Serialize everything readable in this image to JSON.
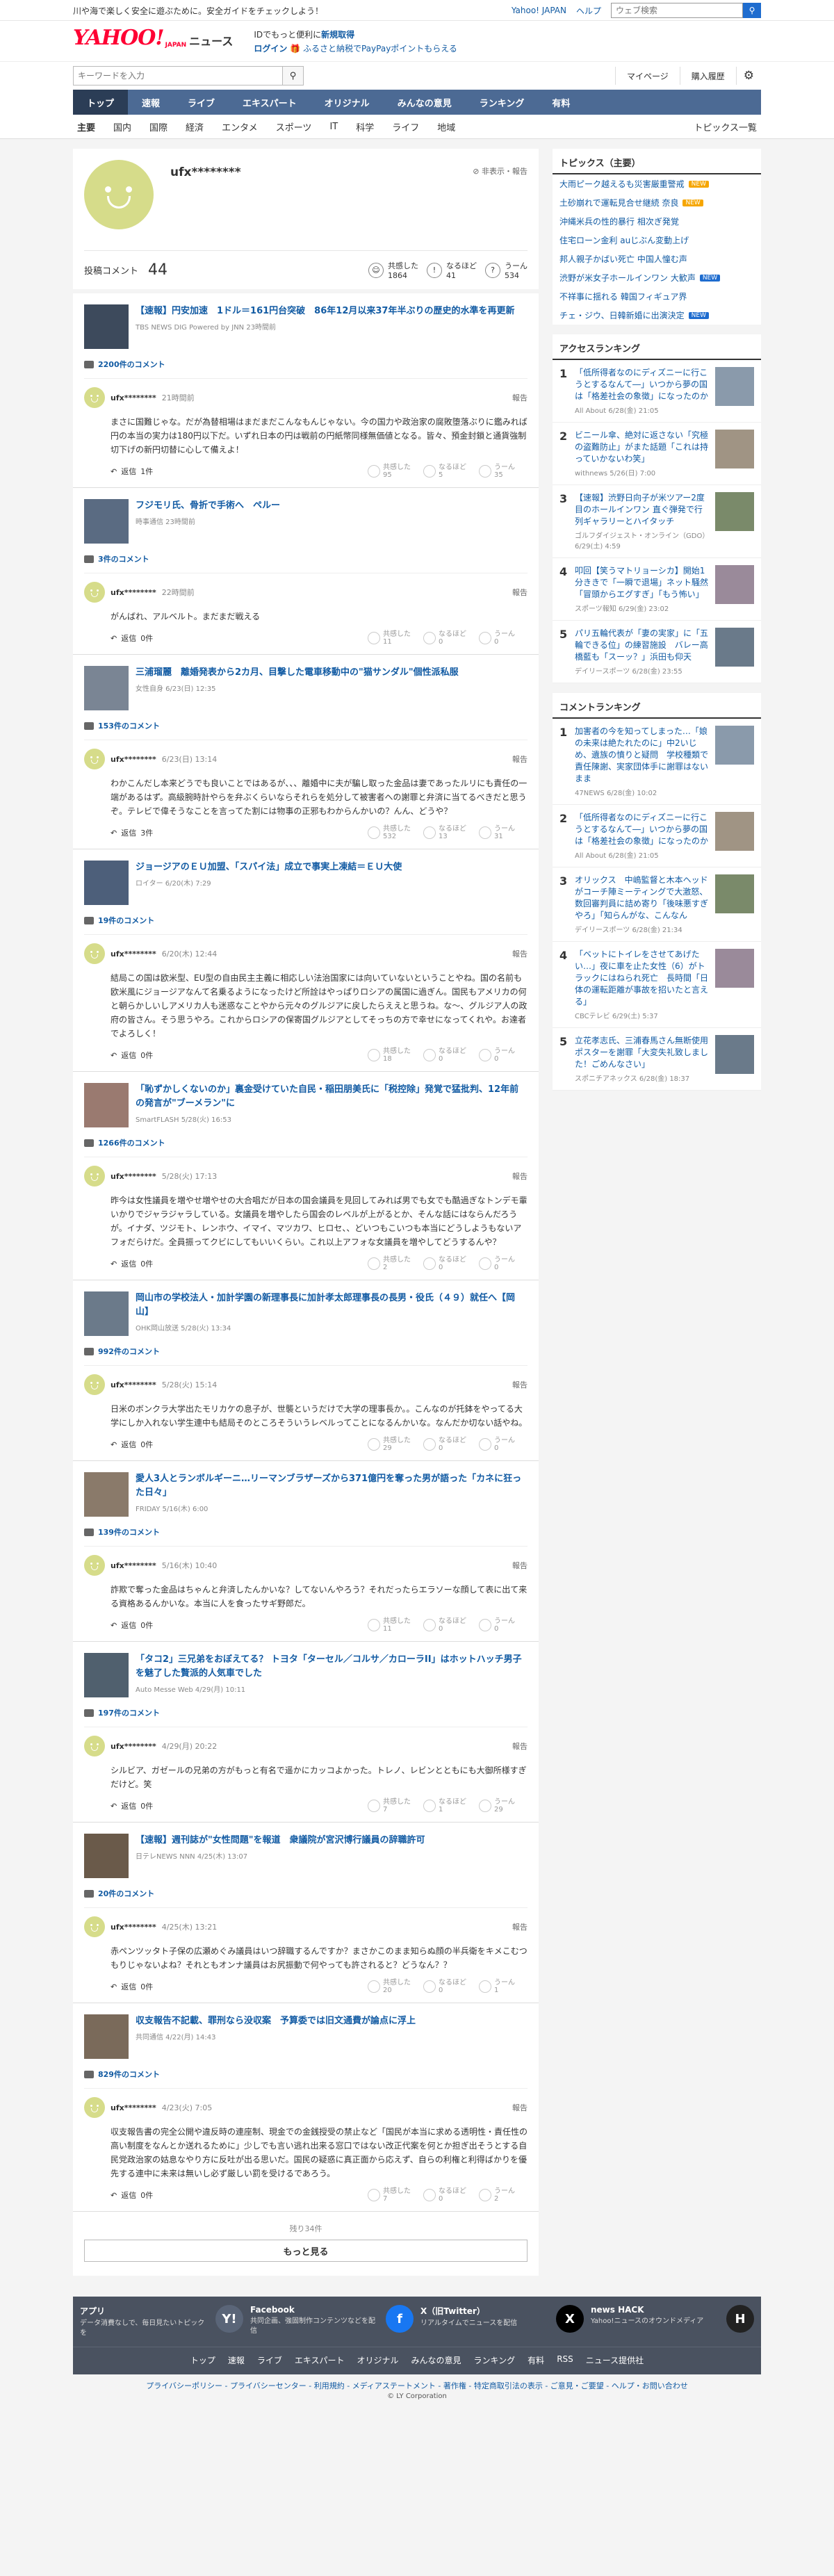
{
  "topbar": {
    "message": "川や海で楽しく安全に遊ぶために。安全ガイドをチェックしよう！",
    "link_japan": "Yahoo! JAPAN",
    "link_help": "ヘルプ",
    "search_placeholder": "ウェブ検索"
  },
  "header": {
    "logo": "YAHOO!",
    "logo_sub": "JAPAN",
    "logo_news": "ニュース",
    "promo_line1_a": "IDでもっと便利に",
    "promo_line1_b": "新規取得",
    "promo_login": "ログイン",
    "promo_line2": "ふるさと納税でPayPayポイントもらえる"
  },
  "searchrow": {
    "placeholder": "キーワードを入力",
    "mypage": "マイページ",
    "purchase": "購入履歴"
  },
  "nav": [
    "トップ",
    "速報",
    "ライブ",
    "エキスパート",
    "オリジナル",
    "みんなの意見",
    "ランキング",
    "有料"
  ],
  "subnav": [
    "主要",
    "国内",
    "国際",
    "経済",
    "エンタメ",
    "スポーツ",
    "IT",
    "科学",
    "ライフ",
    "地域"
  ],
  "subnav_topics": "トピックス一覧",
  "profile": {
    "name": "ufx********",
    "meta": "非表示・報告",
    "count_label": "投稿コメント",
    "count": "44",
    "stat_kyokan": "共感した",
    "stat_kyokan_n": "1864",
    "stat_naruhodo": "なるほど",
    "stat_naruhodo_n": "41",
    "stat_uun": "うーん",
    "stat_uun_n": "534"
  },
  "report_label": "報告",
  "reply_suffix": "返信",
  "react_labels": [
    "共感した",
    "なるほど",
    "うーん"
  ],
  "entries": [
    {
      "title": "【速報】円安加速　1ドル＝161円台突破　86年12月以来37年半ぶりの歴史的水準を再更新",
      "src": "TBS NEWS DIG Powered by JNN  23時間前",
      "count": "2200件のコメント",
      "user": "ufx********",
      "time": "21時間前",
      "text": "まさに国難じゃな。だが為替相場はまだまだこんなもんじゃない。今の国力や政治家の腐敗堕落ぶりに鑑みれば円の本当の実力は180円以下だ。いずれ日本の円は戦前の円紙幣同様無価値となる。皆々、預金封鎖と通貨強制切下げの新円切替に心して備えよ！",
      "replies": "1件",
      "r": [
        "95",
        "5",
        "35"
      ]
    },
    {
      "title": "フジモリ氏、骨折で手術へ　ペルー",
      "src": "時事通信  23時間前",
      "count": "3件のコメント",
      "user": "ufx********",
      "time": "22時間前",
      "text": "がんばれ、アルベルト。まだまだ戦える",
      "replies": "0件",
      "r": [
        "11",
        "0",
        "0"
      ]
    },
    {
      "title": "三浦瑠麗　離婚発表から2カ月、目撃した電車移動中の\"猫サンダル\"個性派私服",
      "src": "女性自身  6/23(日) 12:35",
      "count": "153件のコメント",
      "user": "ufx********",
      "time": "6/23(日) 13:14",
      "text": "わかこんだし本来どうでも良いことではあるが、、、離婚中に夫が騙し取った金品は妻であったルリにも責任の一端があるはず。高級腕時計やらを弁ぶくらいならそれらを処分して被害者への謝罪と弁済に当てるべきだと思うぞ。テレビで偉そうなことを言ってた割には物事の正邪もわからんかいの？んん、どうや？",
      "replies": "3件",
      "r": [
        "532",
        "13",
        "31"
      ]
    },
    {
      "title": "ジョージアのＥＵ加盟、「スパイ法」成立で事実上凍結＝ＥＵ大使",
      "src": "ロイター  6/20(木) 7:29",
      "count": "19件のコメント",
      "user": "ufx********",
      "time": "6/20(木) 12:44",
      "text": "結局この国は欧米型、EU型の自由民主主義に相応しい法治国家には向いていないということやね。国の名前も欧米風にジョージアなんて名乗るようになったけど所詮はやっぱりロシアの属国に過ぎん。国民もアメリカの何と朝らかしいしアメリカ人も迷惑なことやから元々のグルジアに戻したらええと思うね。な～、グルジア人の政府の皆さん。そう思うやろ。これからロシアの保寄国グルジアとしてそっちの方で幸せになってくれや。お達者でよろしく！",
      "replies": "0件",
      "r": [
        "18",
        "0",
        "0"
      ]
    },
    {
      "title": "「恥ずかしくないのか」裏金受けていた自民・稲田朋美氏に「税控除」発覚で猛批判、12年前の発言が\"ブーメラン\"に",
      "src": "SmartFLASH  5/28(火) 16:53",
      "count": "1266件のコメント",
      "user": "ufx********",
      "time": "5/28(火) 17:13",
      "text": "昨今は女性議員を増やせ増やせの大合唱だが日本の国会議員を見回してみれば男でも女でも酷過ぎなトンデモ輩いかりでジャラジャラしている。女議員を増やしたら国会のレベルが上がるとか、そんな話にはならんだろうが。イナダ、ツジモト、レンホウ、イマイ、マツカワ、ヒロセ、、どいつもこいつも本当にどうしようもないアフォだらけだ。全員振ってクビにしてもいいくらい。これ以上アフォな女議員を増やしてどうするんや？",
      "replies": "0件",
      "r": [
        "2",
        "0",
        "0"
      ]
    },
    {
      "title": "岡山市の学校法人・加計学園の新理事長に加計孝太郎理事長の長男・役氏（４９）就任へ【岡山】",
      "src": "OHK岡山放送  5/28(火) 13:34",
      "count": "992件のコメント",
      "user": "ufx********",
      "time": "5/28(火) 15:14",
      "text": "日米のボンクラ大学出たモリカケの息子が、世襲というだけで大学の理事長か。。こんなのが托鉢をやってる大学にしか入れない学生連中も結局そのところそういうレベルってことになるんかいな。なんだか切ない話やね。",
      "replies": "0件",
      "r": [
        "29",
        "0",
        "0"
      ]
    },
    {
      "title": "愛人3人とランボルギーニ…リーマンブラザーズから371億円を奪った男が語った「カネに狂った日々」",
      "src": "FRIDAY  5/16(木) 6:00",
      "count": "139件のコメント",
      "user": "ufx********",
      "time": "5/16(木) 10:40",
      "text": "詐欺で奪った金品はちゃんと弁済したんかいな？してないんやろう？それだったらエラソーな顔して表に出て来る資格あるんかいな。本当に人を食ったサギ野郎だ。",
      "replies": "0件",
      "r": [
        "11",
        "0",
        "0"
      ]
    },
    {
      "title": "「タコ2」三兄弟をおぼえてる？ トヨタ「ターセル／コルサ／カローラII」はホットハッチ男子を魅了した贅派的人気車でした",
      "src": "Auto Messe Web  4/29(月) 10:11",
      "count": "197件のコメント",
      "user": "ufx********",
      "time": "4/29(月) 20:22",
      "text": "シルビア、ガゼールの兄弟の方がもっと有名で遥かにカッコよかった。トレノ、レビンとともにも大御所様すぎだけど。笑",
      "replies": "0件",
      "r": [
        "7",
        "1",
        "29"
      ]
    },
    {
      "title": "【速報】週刊誌が\"女性問題\"を報道　衆議院が宮沢博行議員の辞職許可",
      "src": "日テレNEWS NNN  4/25(木) 13:07",
      "count": "20件のコメント",
      "user": "ufx********",
      "time": "4/25(木) 13:21",
      "text": "赤ペンツッタト子保の広瀬めぐみ議員はいつ辞職するんですか？まさかこのまま知らぬ顔の半兵衛をキメこむつもりじゃないよね？それともオンナ議員はお尻振動で何やっても許されると？どうなん？？",
      "replies": "0件",
      "r": [
        "20",
        "0",
        "1"
      ]
    },
    {
      "title": "収支報告不記載、罪刑なら没収案　予算委では旧文通費が論点に浮上",
      "src": "共同通信  4/22(月) 14:43",
      "count": "829件のコメント",
      "user": "ufx********",
      "time": "4/23(火) 7:05",
      "text": "収支報告書の完全公開や違反時の連座制、現金での金銭授受の禁止など「国民が本当に求める透明性・責任性の高い制度をなんとか送れるために」少しでも言い逃れ出来る窓口ではない改正代案を何とか担ぎ出そうとする自民党政治家の姑息なやり方に反吐が出る思いだ。国民の疑惑に真正面から応えず、自らの利権と利得ばかりを優先する連中に未来は無いし必ず厳しい罰を受けるであろう。",
      "replies": "0件",
      "r": [
        "7",
        "0",
        "2"
      ]
    }
  ],
  "rest_note": "残り34件",
  "more_label": "もっと見る",
  "topics": {
    "title": "トピックス（主要）",
    "items": [
      {
        "text": "大雨ピーク越えるも災害厳重警戒",
        "badge": "NEW",
        "blue": false
      },
      {
        "text": "土砂崩れで運転見合せ継続 奈良",
        "badge": "NEW",
        "blue": false
      },
      {
        "text": "沖縄米兵の性的暴行 相次ぎ発覚",
        "badge": "",
        "blue": false
      },
      {
        "text": "住宅ローン金利 auじぶん変動上げ",
        "badge": "",
        "blue": false
      },
      {
        "text": "邦人親子かばい死亡 中国人憧む声",
        "badge": "",
        "blue": false
      },
      {
        "text": "渋野が米女子ホールインワン 大歓声",
        "badge": "NEW",
        "blue": true
      },
      {
        "text": "不祥事に揺れる 韓国フィギュア界",
        "badge": "",
        "blue": false
      },
      {
        "text": "チェ・ジウ、日韓新婚に出演決定",
        "badge": "NEW",
        "blue": true
      }
    ]
  },
  "access_ranking": {
    "title": "アクセスランキング",
    "items": [
      {
        "no": "1",
        "title": "「低所得者なのにディズニーに行こうとするなんて―」いつから夢の国は「格差社会の象徴」になったのか",
        "src": "All About  6/28(金) 21:05"
      },
      {
        "no": "2",
        "title": "ビニール傘、絶対に返さない「究極の盗難防止」がまた話題「これは持っていかないわ笑」",
        "src": "withnews  5/26(日) 7:00"
      },
      {
        "no": "3",
        "title": "【速報】渋野日向子が米ツアー2度目のホールインワン 直ぐ弾発で行列ギャラリーとハイタッチ",
        "src": "ゴルフダイジェスト・オンライン（GDO）6/29(土) 4:59"
      },
      {
        "no": "4",
        "title": "叩回【笑うマトリョーシカ】開始1分ききで「一瞬で退場」ネット騒然「冒頭からエグすぎ」「もう怖い」",
        "src": "スポーツ報知  6/29(金) 23:02"
      },
      {
        "no": "5",
        "title": "パリ五輪代表が「妻の実家」に「五輪できる位」の練習施設　バレー高橋藍も「スーッ？」浜田も仰天",
        "src": "デイリースポーツ  6/28(金) 23:55"
      }
    ]
  },
  "comment_ranking": {
    "title": "コメントランキング",
    "items": [
      {
        "no": "1",
        "title": "加害者の今を知ってしまった…「娘の未来は絶たれたのに」中2いじめ、遺族の憤りと疑問　学校種類で責任陳謝、実家団体手に謝罪はないまま",
        "src": "47NEWS  6/28(金) 10:02"
      },
      {
        "no": "2",
        "title": "「低所得者なのにディズニーに行こうとするなんて―」いつから夢の国は「格差社会の象徴」になったのか",
        "src": "All About  6/28(金) 21:05"
      },
      {
        "no": "3",
        "title": "オリックス　中嶋監督と木本ヘッドがコーチ陣ミーティングで大激怒、数回審判員に詰め寄り「後味悪すぎやろ」「知らんがな、こんなん",
        "src": "デイリースポーツ  6/28(金) 21:34"
      },
      {
        "no": "4",
        "title": "「ベットにトイレをさせてあげたい…」夜に車を止た女性（6）がトラックにはねられ死亡　長時間「日体の運転距離が事故を招いたと言える」",
        "src": "CBCテレビ  6/29(土) 5:37"
      },
      {
        "no": "5",
        "title": "立花孝志氏、三浦春馬さん無断使用ポスターを謝罪「大変失礼致しました！ごめんなさい」",
        "src": "スポニチアネックス  6/28(金) 18:37"
      }
    ]
  },
  "footer": {
    "cards": [
      {
        "title": "アプリ",
        "desc": "データ消費なしで、毎日見たいトピックを",
        "icon": "Y!"
      },
      {
        "title": "Facebook",
        "desc": "共同企画、強固制作コンテンツなどを配信",
        "icon": "f"
      },
      {
        "title": "X（旧Twitter）",
        "desc": "リアルタイムでニュースを配信",
        "icon": "X"
      },
      {
        "title": "news HACK",
        "desc": "Yahoo!ニュースのオウンドメディア",
        "icon": "H"
      }
    ],
    "links": [
      "トップ",
      "速報",
      "ライブ",
      "エキスパート",
      "オリジナル",
      "みんなの意見",
      "ランキング",
      "有料",
      "RSS",
      "ニュース提供社"
    ],
    "bottom": "プライバシーポリシー - プライバシーセンター - 利用規約 - メディアステートメント - 著作権 - 特定商取引法の表示 - ご意見・ご要望 - ヘルプ・お問い合わせ",
    "copyright": "© LY Corporation"
  },
  "colors": {
    "accent": "#125ba3",
    "nav": "#4c6a94",
    "logo": "#ff0033"
  }
}
